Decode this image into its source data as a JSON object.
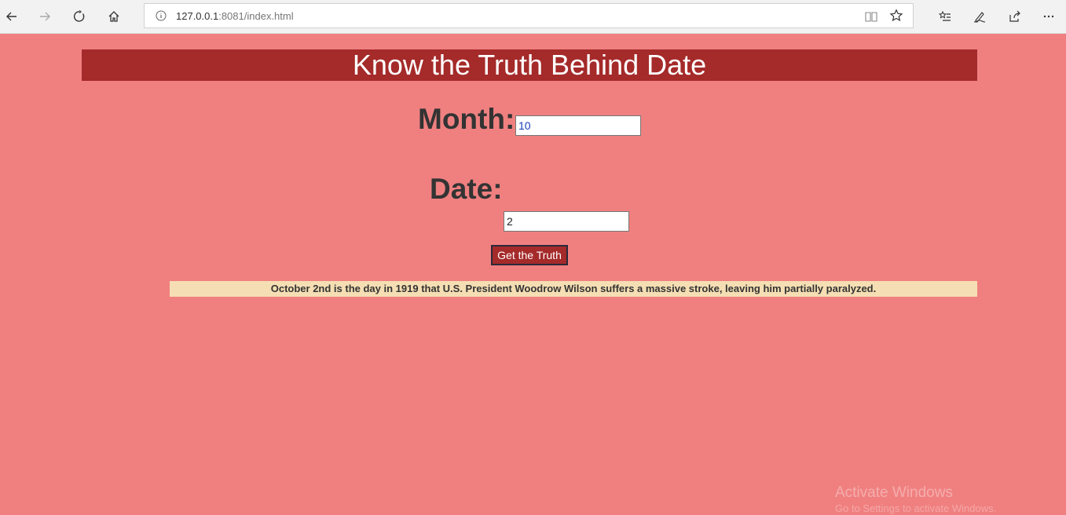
{
  "browser": {
    "url_host": "127.0.0.1",
    "url_rest": ":8081/index.html"
  },
  "page": {
    "title": "Know the Truth Behind Date",
    "month_label": "Month:",
    "month_value": "10",
    "date_label": "Date:",
    "date_value": "2",
    "button_label": "Get the Truth",
    "result_text": "October 2nd is the day in 1919 that U.S. President Woodrow Wilson suffers a massive stroke, leaving him partially paralyzed."
  },
  "watermark": {
    "line1": "Activate Windows",
    "line2": "Go to Settings to activate Windows."
  },
  "colors": {
    "page_background": "#f08080",
    "banner": "#a52a2a",
    "result_background": "#f5deb3"
  }
}
